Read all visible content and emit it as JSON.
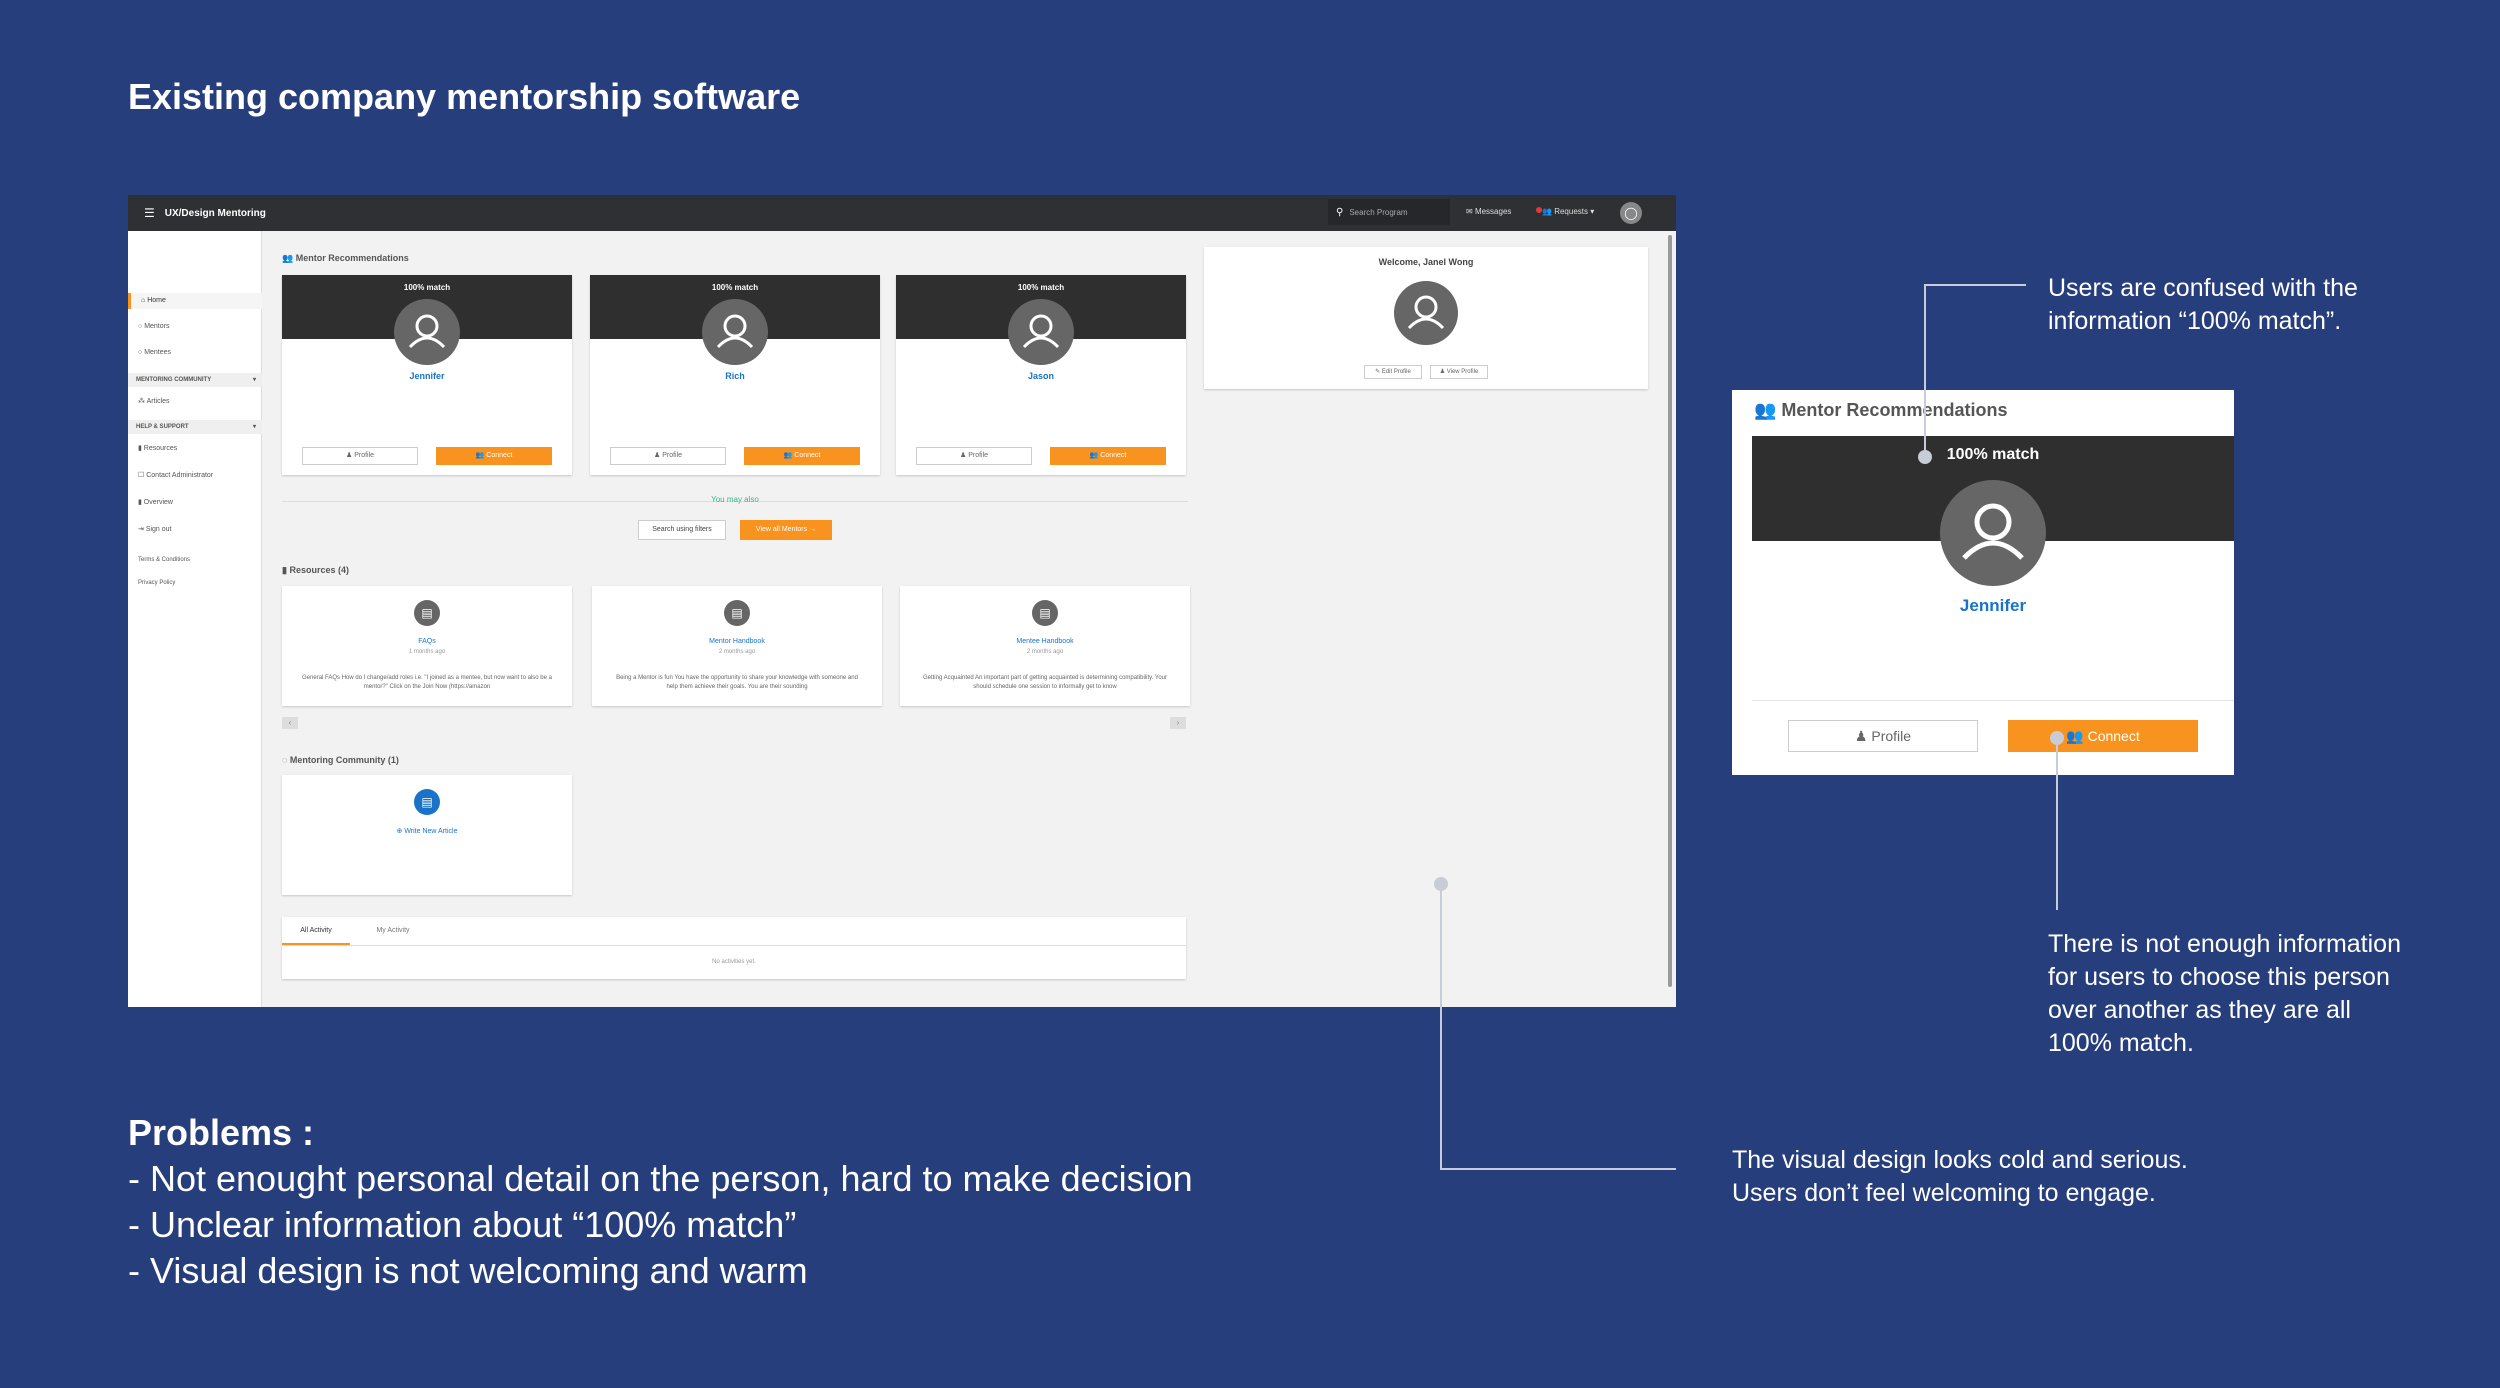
{
  "slide": {
    "title": "Existing company mentorship software"
  },
  "app": {
    "title": "UX/Design Mentoring",
    "topbar": {
      "search_placeholder": "Search Program",
      "messages": "Messages",
      "requests": "Requests"
    },
    "sidebar": {
      "items": [
        "Home",
        "Mentors",
        "Mentees"
      ],
      "community_heading": "MENTORING COMMUNITY",
      "community_items": [
        "Articles"
      ],
      "help_heading": "HELP & SUPPORT",
      "help_items": [
        "Resources",
        "Contact Administrator",
        "Overview",
        "Sign out"
      ],
      "footer_items": [
        "Terms & Conditions",
        "Privacy Policy"
      ]
    },
    "recommendations": {
      "heading": "Mentor Recommendations",
      "cards": [
        {
          "match": "100% match",
          "name": "Jennifer",
          "profile": "Profile",
          "connect": "Connect"
        },
        {
          "match": "100% match",
          "name": "Rich",
          "profile": "Profile",
          "connect": "Connect"
        },
        {
          "match": "100% match",
          "name": "Jason",
          "profile": "Profile",
          "connect": "Connect"
        }
      ],
      "may_also": "You may also",
      "search_filters": "Search using filters",
      "view_all": "View all Mentors →"
    },
    "welcome": {
      "text": "Welcome, Janel Wong",
      "edit_profile": "Edit Profile",
      "view_profile": "View Profile"
    },
    "resources": {
      "heading": "Resources (4)",
      "cards": [
        {
          "title": "FAQs",
          "date": "1 months ago",
          "desc": "General FAQs How do I change/add roles i.e. \"I joined as a mentee, but now want to also be a mentor?\" Click on the Join Now (https://amazon"
        },
        {
          "title": "Mentor Handbook",
          "date": "2 months ago",
          "desc": "Being a Mentor is fun You have the opportunity to share your knowledge with someone and help them achieve their goals. You are their sounding"
        },
        {
          "title": "Mentee Handbook",
          "date": "2 months ago",
          "desc": "Getting Acquainted An important part of getting acquainted is determining compatibility. Your should schedule one session to informally get to know"
        }
      ]
    },
    "community": {
      "heading": "Mentoring Community (1)",
      "link": "Write New Article"
    },
    "activity": {
      "tab_all": "All Activity",
      "tab_my": "My Activity",
      "empty": "No activities yet."
    }
  },
  "zoom_card": {
    "heading": "Mentor Recommendations",
    "match": "100% match",
    "name": "Jennifer",
    "profile": "Profile",
    "connect": "Connect"
  },
  "annotations": {
    "confused": [
      "Users are confused with the",
      "information “100% match”."
    ],
    "not_enough": [
      "There is not enough information",
      "for users to choose this person",
      "over another as they are all",
      "100% match."
    ],
    "visual": [
      "The visual design looks cold and serious.",
      "Users don’t feel welcoming to engage."
    ]
  },
  "problems": {
    "heading": "Problems :",
    "items": [
      "- Not enought personal detail on the person, hard to make decision",
      "- Unclear information about “100% match”",
      "- Visual design is not welcoming and warm"
    ]
  }
}
